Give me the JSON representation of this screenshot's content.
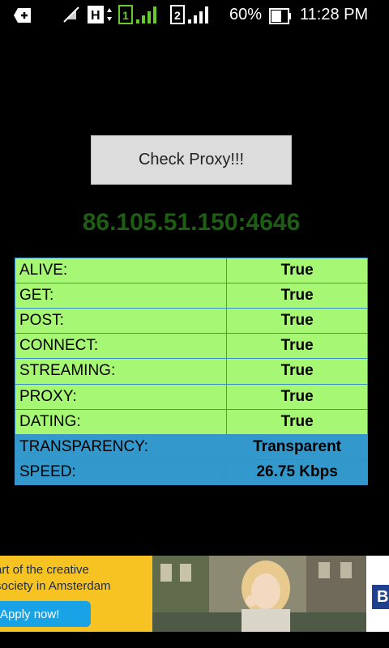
{
  "status_bar": {
    "battery_percent": "60%",
    "time": "11:28 PM",
    "network_type": "H",
    "sim1": "1",
    "sim2": "2"
  },
  "check_button_label": "Check Proxy!!!",
  "proxy_address": "86.105.51.150:4646",
  "results": [
    {
      "label": "ALIVE:",
      "value": "True"
    },
    {
      "label": "GET:",
      "value": "True"
    },
    {
      "label": "POST:",
      "value": "True"
    },
    {
      "label": "CONNECT:",
      "value": "True"
    },
    {
      "label": "STREAMING:",
      "value": "True"
    },
    {
      "label": "PROXY:",
      "value": "True"
    },
    {
      "label": "DATING:",
      "value": "True"
    },
    {
      "label": "TRANSPARENCY:",
      "value": "Transparent"
    },
    {
      "label": "SPEED:",
      "value": "26.75 Kbps"
    }
  ],
  "colors": {
    "true_row": "#a6f773",
    "info_row": "#3399cc",
    "proxy_text": "#1e5e14"
  },
  "ad": {
    "line1": "art of the creative",
    "line2": "society in Amsterdam",
    "button": "Apply now!",
    "right_letter": "B"
  }
}
